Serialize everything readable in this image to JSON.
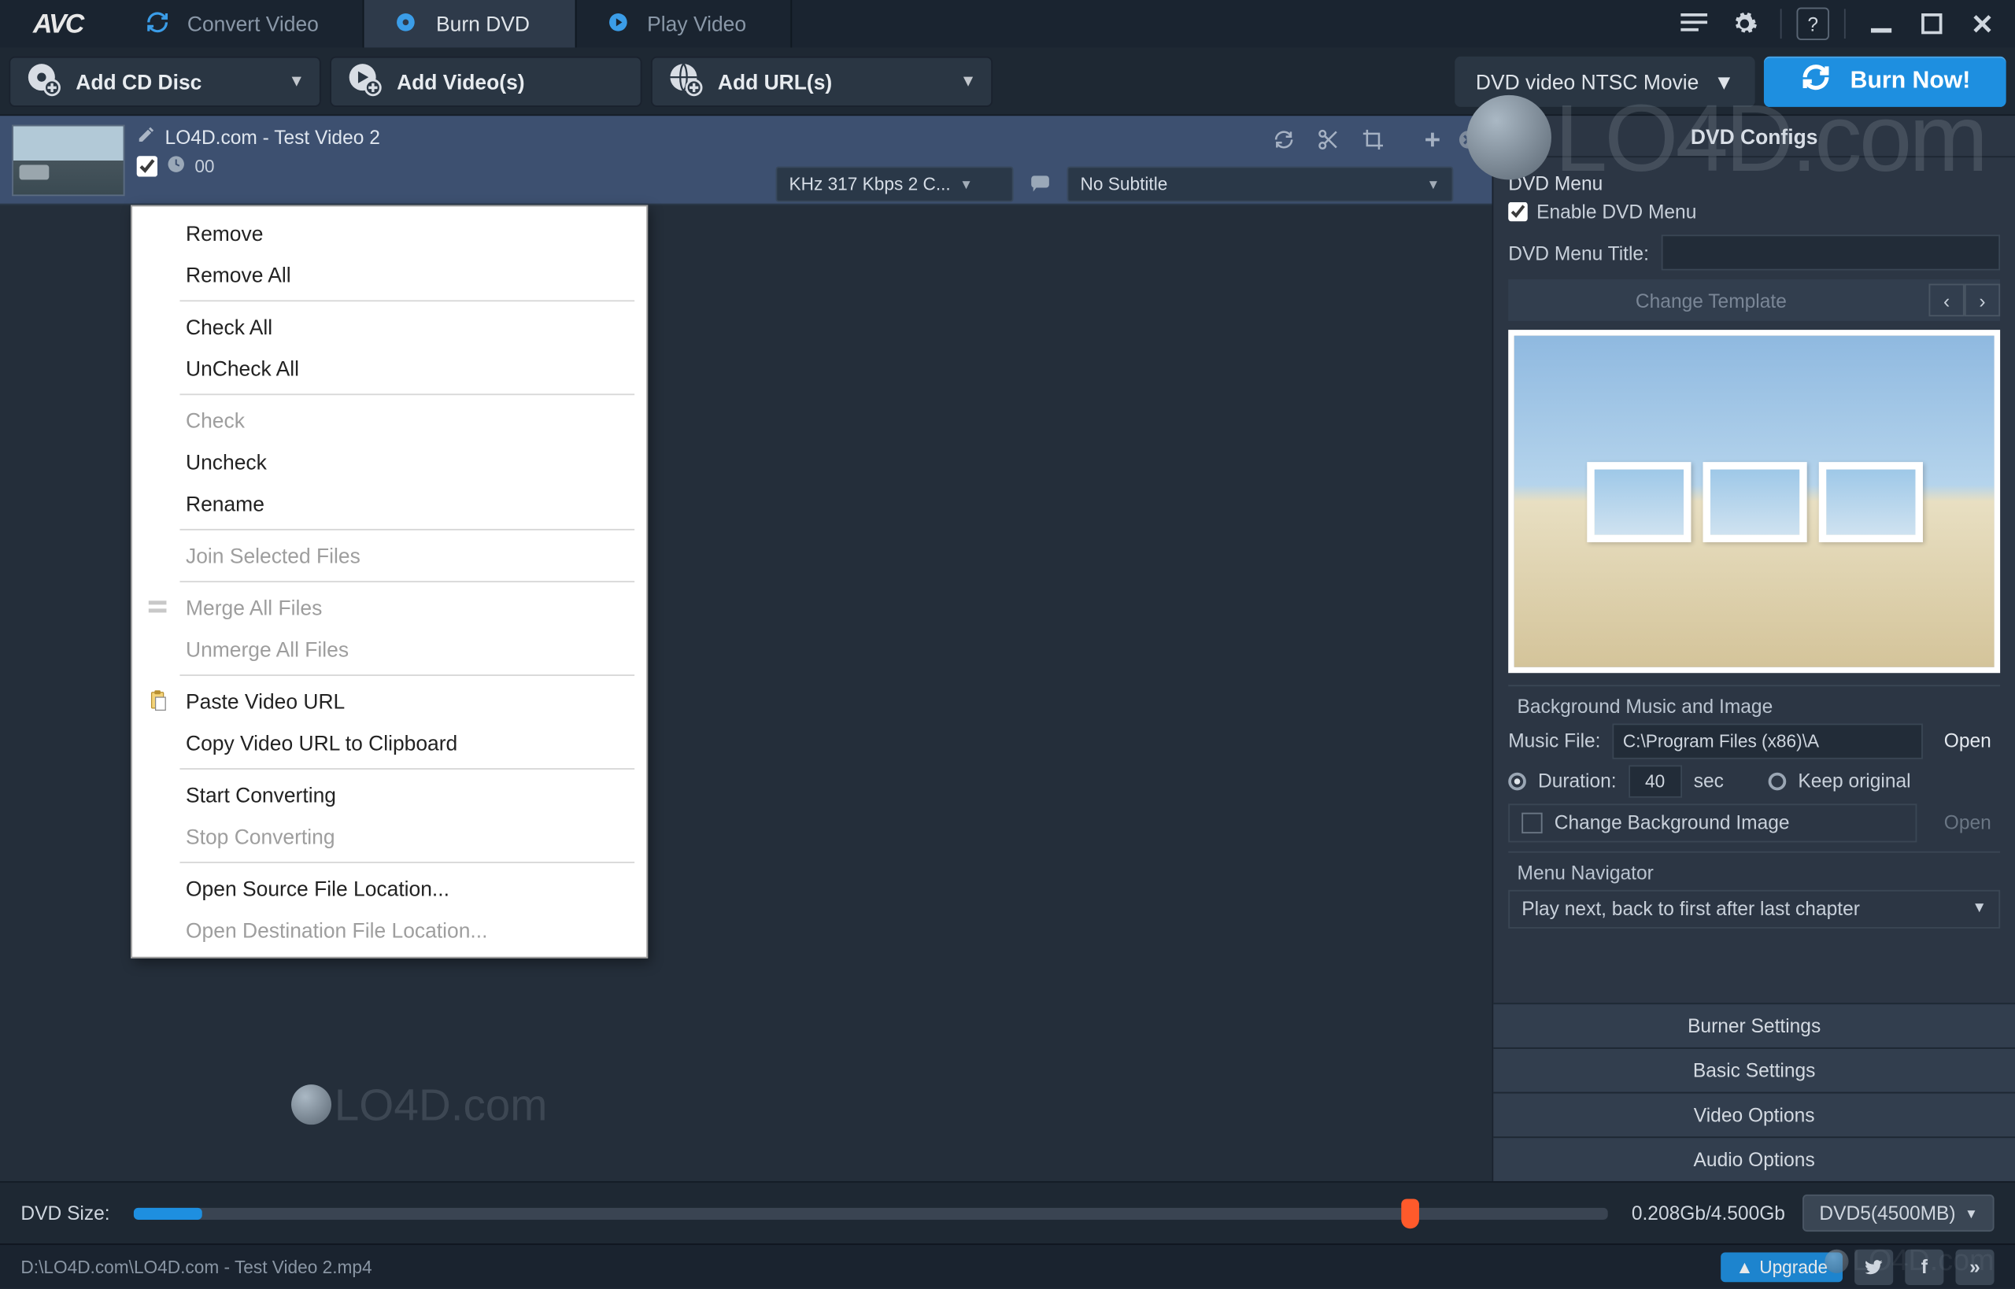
{
  "app": {
    "logo": "AVC"
  },
  "tabs": [
    {
      "label": "Convert Video",
      "active": false
    },
    {
      "label": "Burn DVD",
      "active": true
    },
    {
      "label": "Play Video",
      "active": false
    }
  ],
  "toolbar": {
    "add_disc": "Add CD Disc",
    "add_videos": "Add Video(s)",
    "add_urls": "Add URL(s)",
    "profile": "DVD video NTSC Movie",
    "burn": "Burn Now!"
  },
  "file": {
    "title": "LO4D.com - Test Video 2",
    "duration_prefix": "00",
    "audio_summary": "KHz 317 Kbps 2 C...",
    "subtitle": "No Subtitle"
  },
  "context_menu": [
    {
      "label": "Remove",
      "disabled": false
    },
    {
      "label": "Remove All",
      "disabled": false
    },
    {
      "sep": true
    },
    {
      "label": "Check All",
      "disabled": false
    },
    {
      "label": "UnCheck All",
      "disabled": false
    },
    {
      "sep": true
    },
    {
      "label": "Check",
      "disabled": true
    },
    {
      "label": "Uncheck",
      "disabled": false
    },
    {
      "label": "Rename",
      "disabled": false
    },
    {
      "sep": true
    },
    {
      "label": "Join Selected Files",
      "disabled": true
    },
    {
      "sep": true
    },
    {
      "label": "Merge All Files",
      "disabled": true,
      "icon": "merge"
    },
    {
      "label": "Unmerge All Files",
      "disabled": true
    },
    {
      "sep": true
    },
    {
      "label": "Paste Video URL",
      "disabled": false,
      "icon": "paste"
    },
    {
      "label": "Copy Video URL to Clipboard",
      "disabled": false
    },
    {
      "sep": true
    },
    {
      "label": "Start Converting",
      "disabled": false
    },
    {
      "label": "Stop Converting",
      "disabled": true
    },
    {
      "sep": true
    },
    {
      "label": "Open Source File Location...",
      "disabled": false
    },
    {
      "label": "Open Destination File Location...",
      "disabled": true
    }
  ],
  "sizebar": {
    "label": "DVD Size:",
    "readout": "0.208Gb/4.500Gb",
    "disc": "DVD5(4500MB)"
  },
  "statusbar": {
    "path": "D:\\LO4D.com\\LO4D.com - Test Video 2.mp4",
    "upgrade": "Upgrade"
  },
  "right": {
    "header": "DVD Configs",
    "dvd_menu_label": "DVD Menu",
    "enable_menu": "Enable DVD Menu",
    "menu_title_label": "DVD Menu Title:",
    "menu_title_value": "",
    "change_template": "Change Template",
    "bg_section": "Background Music and Image",
    "music_label": "Music File:",
    "music_path": "C:\\Program Files (x86)\\A",
    "open": "Open",
    "duration_label": "Duration:",
    "duration_value": "40",
    "sec": "sec",
    "keep_original": "Keep original",
    "change_bg": "Change Background Image",
    "navigator_label": "Menu Navigator",
    "navigator_value": "Play next, back to first after last chapter",
    "accordion": [
      "Burner Settings",
      "Basic Settings",
      "Video Options",
      "Audio Options"
    ]
  },
  "watermark": "LO4D.com"
}
